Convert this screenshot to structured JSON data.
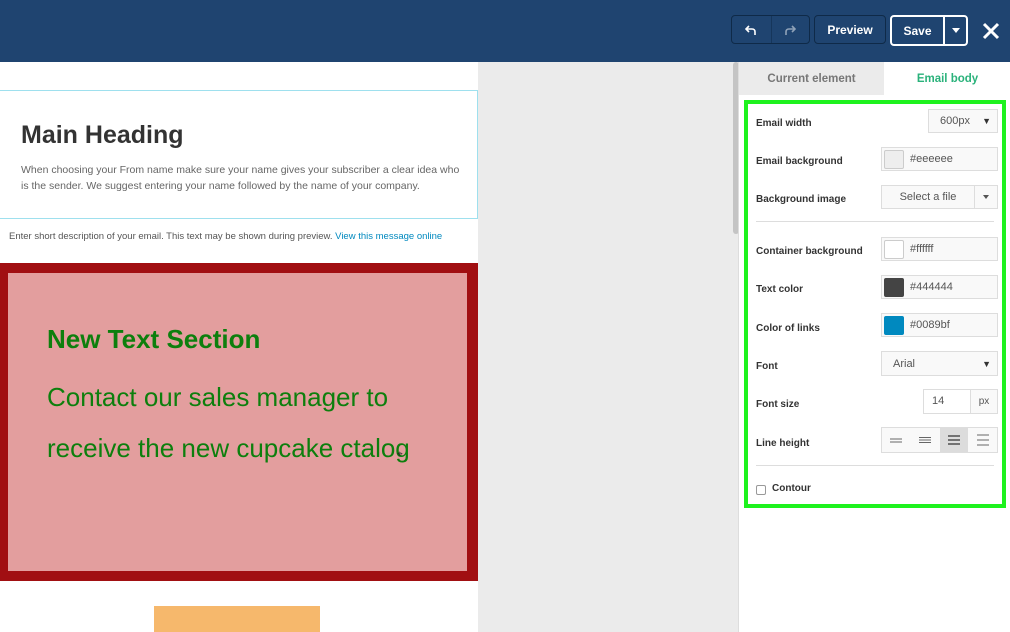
{
  "toolbar": {
    "preview_label": "Preview",
    "save_label": "Save"
  },
  "email": {
    "main_heading": "Main Heading",
    "intro_text": "When choosing your From name make sure your name gives your subscriber a clear idea who is the sender. We suggest entering your name followed by the name of your company.",
    "preheader_text": "Enter short description of your email. This text may be shown during preview.",
    "preheader_link": "View this message online",
    "text_section_heading": "New Text Section",
    "text_section_body": "Contact our sales manager to receive the new cupcake ctalog"
  },
  "panel": {
    "tabs": [
      {
        "label": "Current element",
        "active": false
      },
      {
        "label": "Email body",
        "active": true
      }
    ],
    "settings": {
      "email_width": {
        "label": "Email width",
        "value": "600px"
      },
      "email_background": {
        "label": "Email background",
        "value": "#eeeeee"
      },
      "background_image": {
        "label": "Background image",
        "button": "Select a file"
      },
      "container_background": {
        "label": "Container background",
        "value": "#ffffff"
      },
      "text_color": {
        "label": "Text color",
        "value": "#444444"
      },
      "link_color": {
        "label": "Color of links",
        "value": "#0089bf"
      },
      "font": {
        "label": "Font",
        "value": "Arial"
      },
      "font_size": {
        "label": "Font size",
        "value": "14",
        "unit": "px"
      },
      "line_height": {
        "label": "Line height",
        "selected_index": 2
      },
      "contour": {
        "label": "Contour",
        "checked": false
      }
    }
  },
  "colors": {
    "topbar": "#1f4470",
    "accent_green": "#2ab27b",
    "highlight_border": "#1ef21e",
    "text_section_outer": "#a10f12",
    "text_section_inner": "#e39e9e",
    "text_section_text": "#0d7f0d",
    "button_block": "#f6b86c"
  },
  "icons": [
    "undo-icon",
    "redo-icon",
    "caret-down-icon",
    "close-icon",
    "line-height-icon"
  ]
}
